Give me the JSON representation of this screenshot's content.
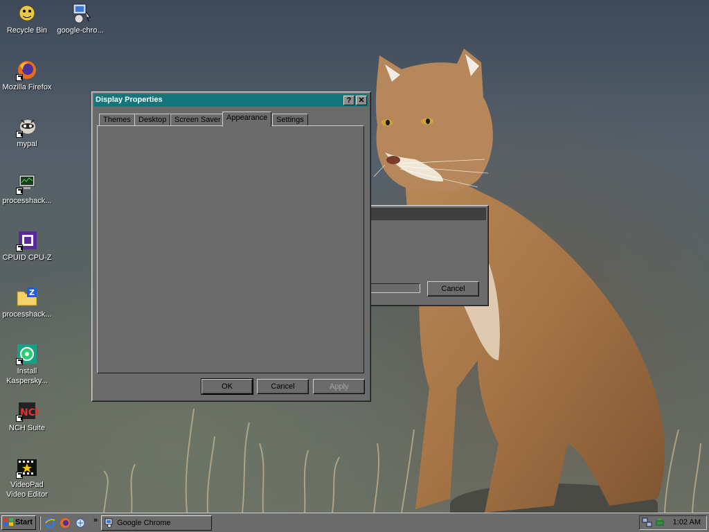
{
  "desktop": {
    "icons": [
      {
        "label": "Recycle Bin"
      },
      {
        "label": "google-chro..."
      },
      {
        "label": "Mozilla Firefox"
      },
      {
        "label": "mypal"
      },
      {
        "label": "processhack..."
      },
      {
        "label": "CPUID CPU-Z"
      },
      {
        "label": "processhack..."
      },
      {
        "label": "Install Kaspersky..."
      },
      {
        "label": "NCH Suite"
      },
      {
        "label": "VideoPad Video Editor"
      }
    ]
  },
  "display_properties": {
    "title": "Display Properties",
    "help_button": "?",
    "close_button": "✕",
    "tabs": [
      {
        "label": "Themes"
      },
      {
        "label": "Desktop"
      },
      {
        "label": "Screen Saver"
      },
      {
        "label": "Appearance"
      },
      {
        "label": "Settings"
      }
    ],
    "active_tab": "Appearance",
    "buttons": {
      "ok": "OK",
      "cancel": "Cancel",
      "apply": "Apply"
    }
  },
  "background_dialog": {
    "cancel_label": "Cancel"
  },
  "taskbar": {
    "start_label": "Start",
    "chevron": "»",
    "task_button": "Google Chrome",
    "clock": "1:02 AM"
  },
  "colors": {
    "titlebar": "#14767a",
    "window_face": "#6b6b6b"
  }
}
